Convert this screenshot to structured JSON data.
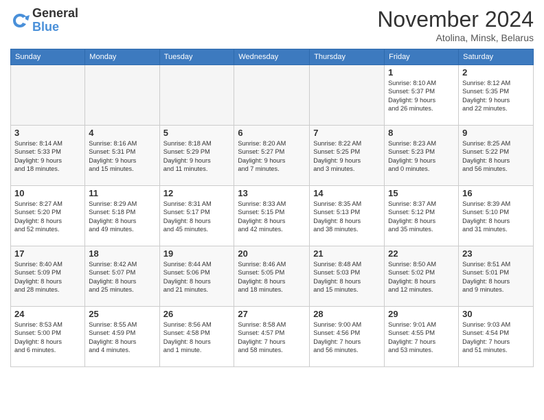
{
  "header": {
    "logo_line1": "General",
    "logo_line2": "Blue",
    "month": "November 2024",
    "location": "Atolina, Minsk, Belarus"
  },
  "weekdays": [
    "Sunday",
    "Monday",
    "Tuesday",
    "Wednesday",
    "Thursday",
    "Friday",
    "Saturday"
  ],
  "weeks": [
    [
      {
        "day": "",
        "info": ""
      },
      {
        "day": "",
        "info": ""
      },
      {
        "day": "",
        "info": ""
      },
      {
        "day": "",
        "info": ""
      },
      {
        "day": "",
        "info": ""
      },
      {
        "day": "1",
        "info": "Sunrise: 8:10 AM\nSunset: 5:37 PM\nDaylight: 9 hours\nand 26 minutes."
      },
      {
        "day": "2",
        "info": "Sunrise: 8:12 AM\nSunset: 5:35 PM\nDaylight: 9 hours\nand 22 minutes."
      }
    ],
    [
      {
        "day": "3",
        "info": "Sunrise: 8:14 AM\nSunset: 5:33 PM\nDaylight: 9 hours\nand 18 minutes."
      },
      {
        "day": "4",
        "info": "Sunrise: 8:16 AM\nSunset: 5:31 PM\nDaylight: 9 hours\nand 15 minutes."
      },
      {
        "day": "5",
        "info": "Sunrise: 8:18 AM\nSunset: 5:29 PM\nDaylight: 9 hours\nand 11 minutes."
      },
      {
        "day": "6",
        "info": "Sunrise: 8:20 AM\nSunset: 5:27 PM\nDaylight: 9 hours\nand 7 minutes."
      },
      {
        "day": "7",
        "info": "Sunrise: 8:22 AM\nSunset: 5:25 PM\nDaylight: 9 hours\nand 3 minutes."
      },
      {
        "day": "8",
        "info": "Sunrise: 8:23 AM\nSunset: 5:23 PM\nDaylight: 9 hours\nand 0 minutes."
      },
      {
        "day": "9",
        "info": "Sunrise: 8:25 AM\nSunset: 5:22 PM\nDaylight: 8 hours\nand 56 minutes."
      }
    ],
    [
      {
        "day": "10",
        "info": "Sunrise: 8:27 AM\nSunset: 5:20 PM\nDaylight: 8 hours\nand 52 minutes."
      },
      {
        "day": "11",
        "info": "Sunrise: 8:29 AM\nSunset: 5:18 PM\nDaylight: 8 hours\nand 49 minutes."
      },
      {
        "day": "12",
        "info": "Sunrise: 8:31 AM\nSunset: 5:17 PM\nDaylight: 8 hours\nand 45 minutes."
      },
      {
        "day": "13",
        "info": "Sunrise: 8:33 AM\nSunset: 5:15 PM\nDaylight: 8 hours\nand 42 minutes."
      },
      {
        "day": "14",
        "info": "Sunrise: 8:35 AM\nSunset: 5:13 PM\nDaylight: 8 hours\nand 38 minutes."
      },
      {
        "day": "15",
        "info": "Sunrise: 8:37 AM\nSunset: 5:12 PM\nDaylight: 8 hours\nand 35 minutes."
      },
      {
        "day": "16",
        "info": "Sunrise: 8:39 AM\nSunset: 5:10 PM\nDaylight: 8 hours\nand 31 minutes."
      }
    ],
    [
      {
        "day": "17",
        "info": "Sunrise: 8:40 AM\nSunset: 5:09 PM\nDaylight: 8 hours\nand 28 minutes."
      },
      {
        "day": "18",
        "info": "Sunrise: 8:42 AM\nSunset: 5:07 PM\nDaylight: 8 hours\nand 25 minutes."
      },
      {
        "day": "19",
        "info": "Sunrise: 8:44 AM\nSunset: 5:06 PM\nDaylight: 8 hours\nand 21 minutes."
      },
      {
        "day": "20",
        "info": "Sunrise: 8:46 AM\nSunset: 5:05 PM\nDaylight: 8 hours\nand 18 minutes."
      },
      {
        "day": "21",
        "info": "Sunrise: 8:48 AM\nSunset: 5:03 PM\nDaylight: 8 hours\nand 15 minutes."
      },
      {
        "day": "22",
        "info": "Sunrise: 8:50 AM\nSunset: 5:02 PM\nDaylight: 8 hours\nand 12 minutes."
      },
      {
        "day": "23",
        "info": "Sunrise: 8:51 AM\nSunset: 5:01 PM\nDaylight: 8 hours\nand 9 minutes."
      }
    ],
    [
      {
        "day": "24",
        "info": "Sunrise: 8:53 AM\nSunset: 5:00 PM\nDaylight: 8 hours\nand 6 minutes."
      },
      {
        "day": "25",
        "info": "Sunrise: 8:55 AM\nSunset: 4:59 PM\nDaylight: 8 hours\nand 4 minutes."
      },
      {
        "day": "26",
        "info": "Sunrise: 8:56 AM\nSunset: 4:58 PM\nDaylight: 8 hours\nand 1 minute."
      },
      {
        "day": "27",
        "info": "Sunrise: 8:58 AM\nSunset: 4:57 PM\nDaylight: 7 hours\nand 58 minutes."
      },
      {
        "day": "28",
        "info": "Sunrise: 9:00 AM\nSunset: 4:56 PM\nDaylight: 7 hours\nand 56 minutes."
      },
      {
        "day": "29",
        "info": "Sunrise: 9:01 AM\nSunset: 4:55 PM\nDaylight: 7 hours\nand 53 minutes."
      },
      {
        "day": "30",
        "info": "Sunrise: 9:03 AM\nSunset: 4:54 PM\nDaylight: 7 hours\nand 51 minutes."
      }
    ]
  ]
}
